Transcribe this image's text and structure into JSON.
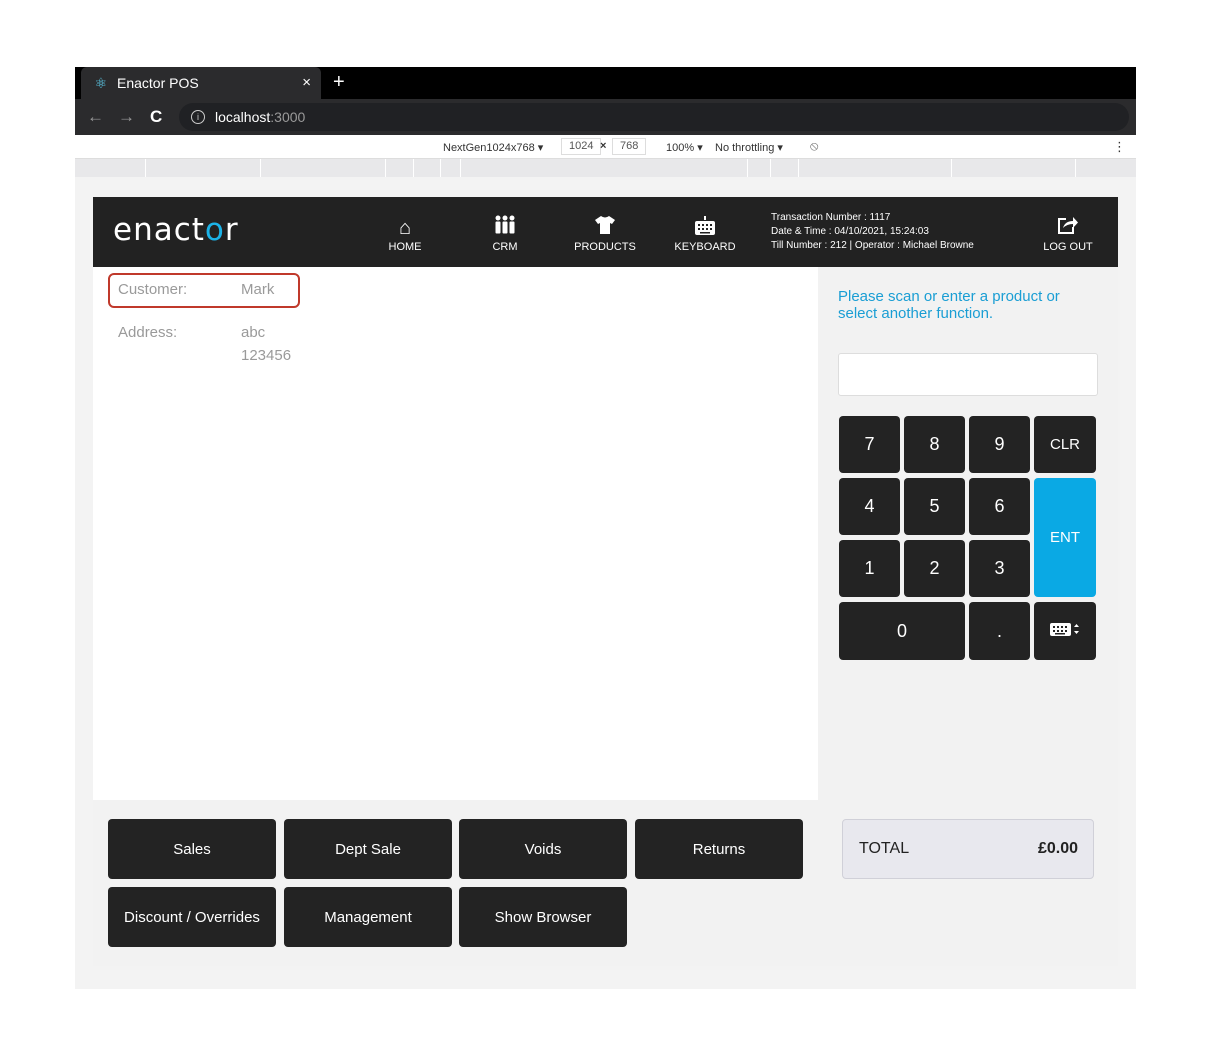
{
  "browser": {
    "tab_title": "Enactor POS",
    "tab_close": "×",
    "new_tab": "+",
    "url_host": "localhost",
    "url_port": ":3000"
  },
  "devtools": {
    "device": "NextGen1024x768 ▾",
    "width": "1024",
    "height": "768",
    "dim_separator": "×",
    "zoom": "100% ▾",
    "throttling": "No throttling ▾"
  },
  "header": {
    "logo_part1": "enact",
    "logo_accent": "o",
    "logo_part2": "r",
    "nav": {
      "home": "HOME",
      "crm": "CRM",
      "products": "PRODUCTS",
      "keyboard": "KEYBOARD",
      "logout": "LOG OUT"
    },
    "transaction_number": "Transaction Number : 1117",
    "date_time": "Date & Time : 04/10/2021, 15:24:03",
    "till_operator": "Till Number : 212  |  Operator : Michael Browne"
  },
  "customer": {
    "customer_label": "Customer:",
    "customer_value": "Mark",
    "address_label": "Address:",
    "address_line1": "abc",
    "address_line2": "123456"
  },
  "prompt": {
    "line1": "Please scan or enter a product or",
    "line2": "select another function."
  },
  "keypad": {
    "k7": "7",
    "k8": "8",
    "k9": "9",
    "clr": "CLR",
    "k4": "4",
    "k5": "5",
    "k6": "6",
    "ent": "ENT",
    "k1": "1",
    "k2": "2",
    "k3": "3",
    "k0": "0",
    "dot": "."
  },
  "functions": {
    "sales": "Sales",
    "dept_sale": "Dept Sale",
    "voids": "Voids",
    "returns": "Returns",
    "discount": "Discount / Overrides",
    "management": "Management",
    "show_browser": "Show Browser"
  },
  "total": {
    "label": "TOTAL",
    "value": "£0.00"
  },
  "colors": {
    "accent": "#0aa9e4",
    "header_bg": "#222222",
    "key_bg": "#232323",
    "highlight_border": "#c0392b"
  }
}
